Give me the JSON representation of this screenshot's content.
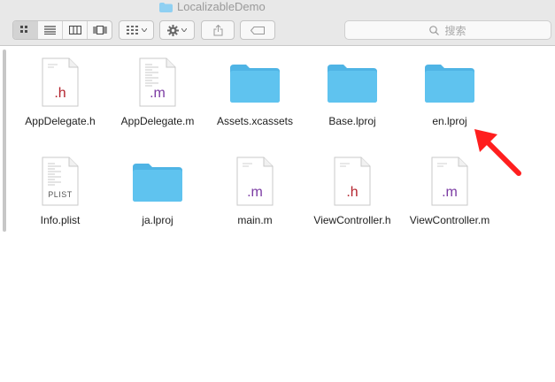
{
  "window": {
    "title": "LocalizableDemo"
  },
  "toolbar": {
    "view_icons": [
      "icon-view-icon",
      "list-view-icon",
      "column-view-icon",
      "gallery-view-icon"
    ],
    "search_placeholder": "搜索"
  },
  "files": [
    {
      "name": "AppDelegate.h",
      "kind": "doc",
      "ext": ".h"
    },
    {
      "name": "AppDelegate.m",
      "kind": "doc-lined",
      "ext": ".m"
    },
    {
      "name": "Assets.xcassets",
      "kind": "folder"
    },
    {
      "name": "Base.lproj",
      "kind": "folder"
    },
    {
      "name": "en.lproj",
      "kind": "folder"
    },
    {
      "name": "Info.plist",
      "kind": "doc-lined",
      "ext": "PLIST"
    },
    {
      "name": "ja.lproj",
      "kind": "folder"
    },
    {
      "name": "main.m",
      "kind": "doc",
      "ext": ".m"
    },
    {
      "name": "ViewController.h",
      "kind": "doc",
      "ext": ".h"
    },
    {
      "name": "ViewController.m",
      "kind": "doc",
      "ext": ".m"
    }
  ],
  "colors": {
    "folder": "#5fc3ef",
    "arrow": "#ff1e1e",
    "ext_h": "#b4242e",
    "ext_m": "#7b3ba3"
  }
}
